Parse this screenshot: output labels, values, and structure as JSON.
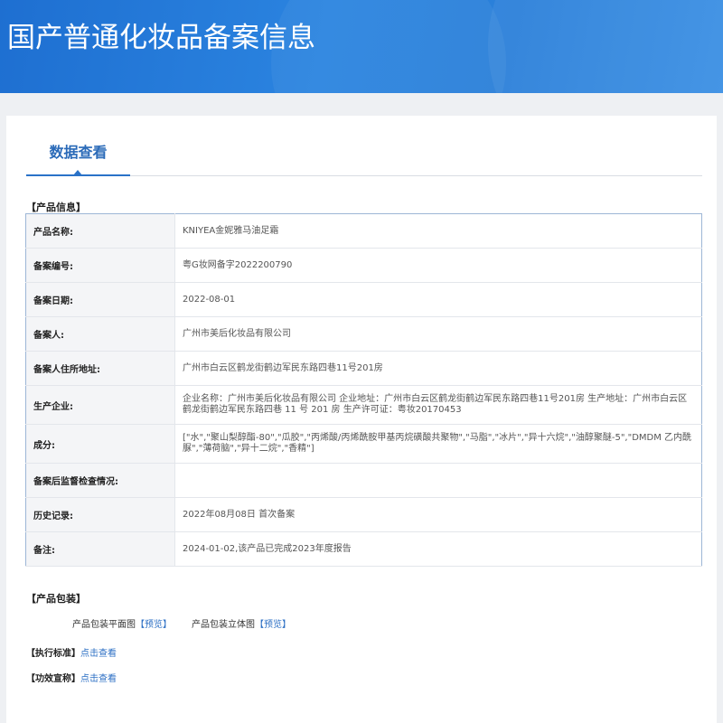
{
  "banner": {
    "title": "国产普通化妆品备案信息"
  },
  "tab": {
    "label": "数据查看"
  },
  "product_info": {
    "section_label": "【产品信息】",
    "rows": [
      {
        "key": "产品名称:",
        "value": "KNIYEA金妮雅马油足霜"
      },
      {
        "key": "备案编号:",
        "value": "粤G妆网备字2022200790"
      },
      {
        "key": "备案日期:",
        "value": "2022-08-01"
      },
      {
        "key": "备案人:",
        "value": "广州市美后化妆品有限公司"
      },
      {
        "key": "备案人住所地址:",
        "value": "广州市白云区鹤龙街鹤边军民东路四巷11号201房"
      },
      {
        "key": "生产企业:",
        "value": "企业名称：广州市美后化妆品有限公司 企业地址：广州市白云区鹤龙街鹤边军民东路四巷11号201房 生产地址：广州市白云区鹤龙街鹤边军民东路四巷 11 号 201 房 生产许可证：粤妆20170453"
      },
      {
        "key": "成分:",
        "value": "[\"水\",\"聚山梨醇酯-80\",\"瓜胶\",\"丙烯酸/丙烯酰胺甲基丙烷磺酸共聚物\",\"马脂\",\"冰片\",\"异十六烷\",\"油醇聚醚-5\",\"DMDM 乙内酰脲\",\"薄荷脑\",\"异十二烷\",\"香精\"]"
      },
      {
        "key": "备案后监督检查情况:",
        "value": ""
      },
      {
        "key": "历史记录:",
        "value": "2022年08月08日 首次备案"
      },
      {
        "key": "备注:",
        "value": "2024-01-02,该产品已完成2023年度报告"
      }
    ]
  },
  "packaging": {
    "section_label": "【产品包装】",
    "flat_label": "产品包装平面图",
    "solid_label": "产品包装立体图",
    "preview_label": "预览",
    "bracket_open": "【",
    "bracket_close": "】"
  },
  "standard": {
    "label": "【执行标准】",
    "link": "点击查看"
  },
  "efficacy": {
    "label": "【功效宣称】",
    "link": "点击查看"
  }
}
